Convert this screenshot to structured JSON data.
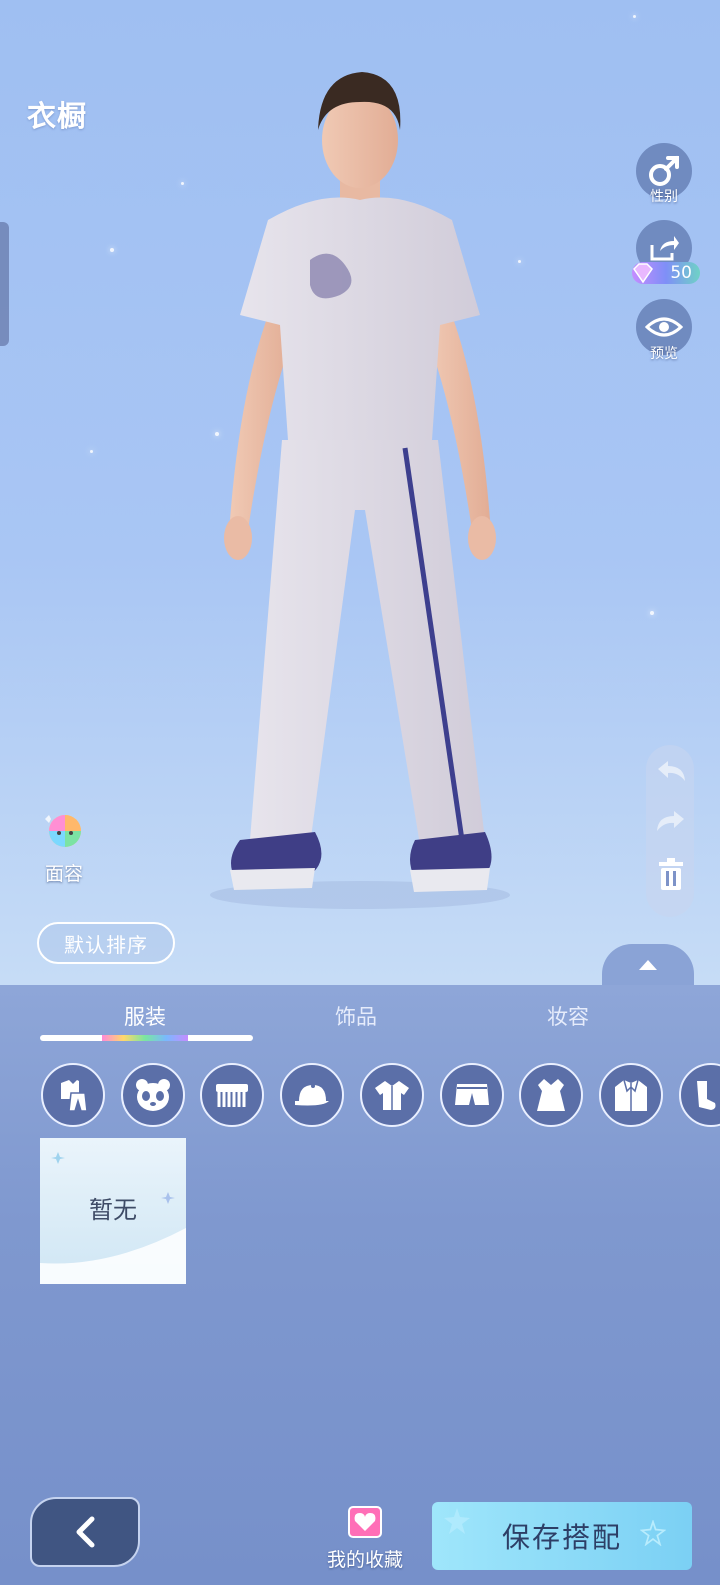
{
  "header": {
    "title": "衣橱"
  },
  "side_actions": {
    "gender_label": "性别",
    "share_reward": "50",
    "preview_label": "预览"
  },
  "face_button": {
    "label": "面容"
  },
  "sort_button": {
    "label": "默认排序"
  },
  "tabs": [
    {
      "label": "服装",
      "active": true
    },
    {
      "label": "饰品",
      "active": false
    },
    {
      "label": "妆容",
      "active": false
    }
  ],
  "categories": [
    {
      "icon": "outfit-set-icon"
    },
    {
      "icon": "panda-face-icon"
    },
    {
      "icon": "comb-icon"
    },
    {
      "icon": "cap-icon"
    },
    {
      "icon": "shirt-icon"
    },
    {
      "icon": "shorts-icon"
    },
    {
      "icon": "dress-icon"
    },
    {
      "icon": "jacket-icon"
    },
    {
      "icon": "socks-icon"
    }
  ],
  "item_grid": {
    "empty_text": "暂无"
  },
  "footer": {
    "favorites_label": "我的收藏",
    "save_label": "保存搭配"
  },
  "colors": {
    "accent_save": "#8fdcf8",
    "panel_bg": "#7f98cf",
    "icon_btn": "#5b6fa8"
  }
}
